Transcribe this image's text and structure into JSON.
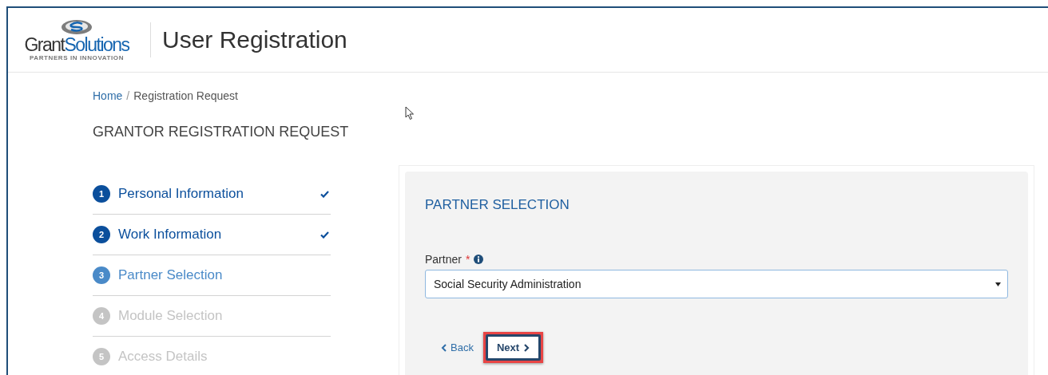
{
  "header": {
    "logo": {
      "name_start": "Grant",
      "name_end": "Solutions",
      "tagline": "PARTNERS IN INNOVATION"
    },
    "title": "User Registration"
  },
  "breadcrumb": {
    "separator": "/",
    "items": [
      {
        "label": "Home",
        "kind": "link"
      },
      {
        "label": "Registration Request",
        "kind": "current"
      }
    ]
  },
  "heading": "GRANTOR REGISTRATION REQUEST",
  "steps": [
    {
      "number": "1",
      "label": "Personal Information",
      "completed": true,
      "selected": false,
      "disabled": false
    },
    {
      "number": "2",
      "label": "Work Information",
      "completed": true,
      "selected": false,
      "disabled": false
    },
    {
      "number": "3",
      "label": "Partner Selection",
      "completed": false,
      "selected": true,
      "disabled": false
    },
    {
      "number": "4",
      "label": "Module Selection",
      "completed": false,
      "selected": false,
      "disabled": true
    },
    {
      "number": "5",
      "label": "Access Details",
      "completed": false,
      "selected": false,
      "disabled": true
    }
  ],
  "panel": {
    "title": "PARTNER SELECTION",
    "field": {
      "label": "Partner",
      "required_mark": "*",
      "value": "Social Security Administration"
    },
    "back_button": {
      "label": "Back"
    },
    "next_button": {
      "label": "Next",
      "highlighted": true
    }
  }
}
